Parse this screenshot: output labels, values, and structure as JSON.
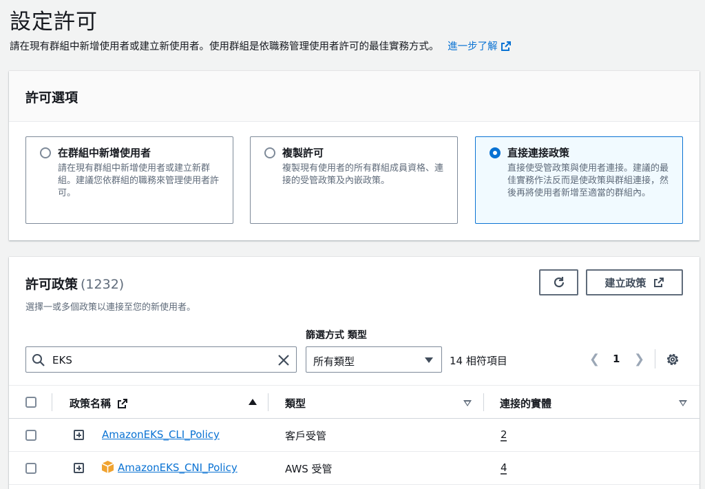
{
  "header": {
    "title": "設定許可",
    "description": "請在現有群組中新增使用者或建立新使用者。使用群組是依職務管理使用者許可的最佳實務方式。",
    "learn_more": "進一步了解"
  },
  "options": {
    "title": "許可選項",
    "tiles": [
      {
        "label": "在群組中新增使用者",
        "description": "請在現有群組中新增使用者或建立新群組。建議您依群組的職務來管理使用者許可。",
        "selected": false
      },
      {
        "label": "複製許可",
        "description": "複製現有使用者的所有群組成員資格、連接的受管政策及內嵌政策。",
        "selected": false
      },
      {
        "label": "直接連接政策",
        "description": "直接使受管政策與使用者連接。建議的最佳實務作法反而是使政策與群組連接，然後再將使用者新增至適當的群組內。",
        "selected": true
      }
    ]
  },
  "policies": {
    "title": "許可政策",
    "count": "(1232)",
    "description": "選擇一或多個政策以連接至您的新使用者。",
    "create_label": "建立政策",
    "filter_label": "篩選方式 類型",
    "search_value": "EKS",
    "type_select": "所有類型",
    "match_count": "14 相符項目",
    "page": "1",
    "columns": {
      "name": "政策名稱",
      "type": "類型",
      "entities": "連接的實體"
    },
    "rows": [
      {
        "name": "AmazonEKS_CLI_Policy",
        "type": "客戶受管",
        "entities": "2"
      },
      {
        "name": "AmazonEKS_CNI_Policy",
        "type": "AWS 受管",
        "entities": "4"
      }
    ]
  },
  "colors": {
    "accent": "#0972d3",
    "text": "#16191f",
    "muted": "#5f6b7a"
  },
  "icons": [
    "external-link-icon",
    "refresh-icon",
    "search-icon",
    "clear-icon",
    "chevron-left-icon",
    "chevron-right-icon",
    "gear-icon",
    "expand-icon",
    "aws-box-icon",
    "sort-asc-icon",
    "sort-desc-icon"
  ]
}
